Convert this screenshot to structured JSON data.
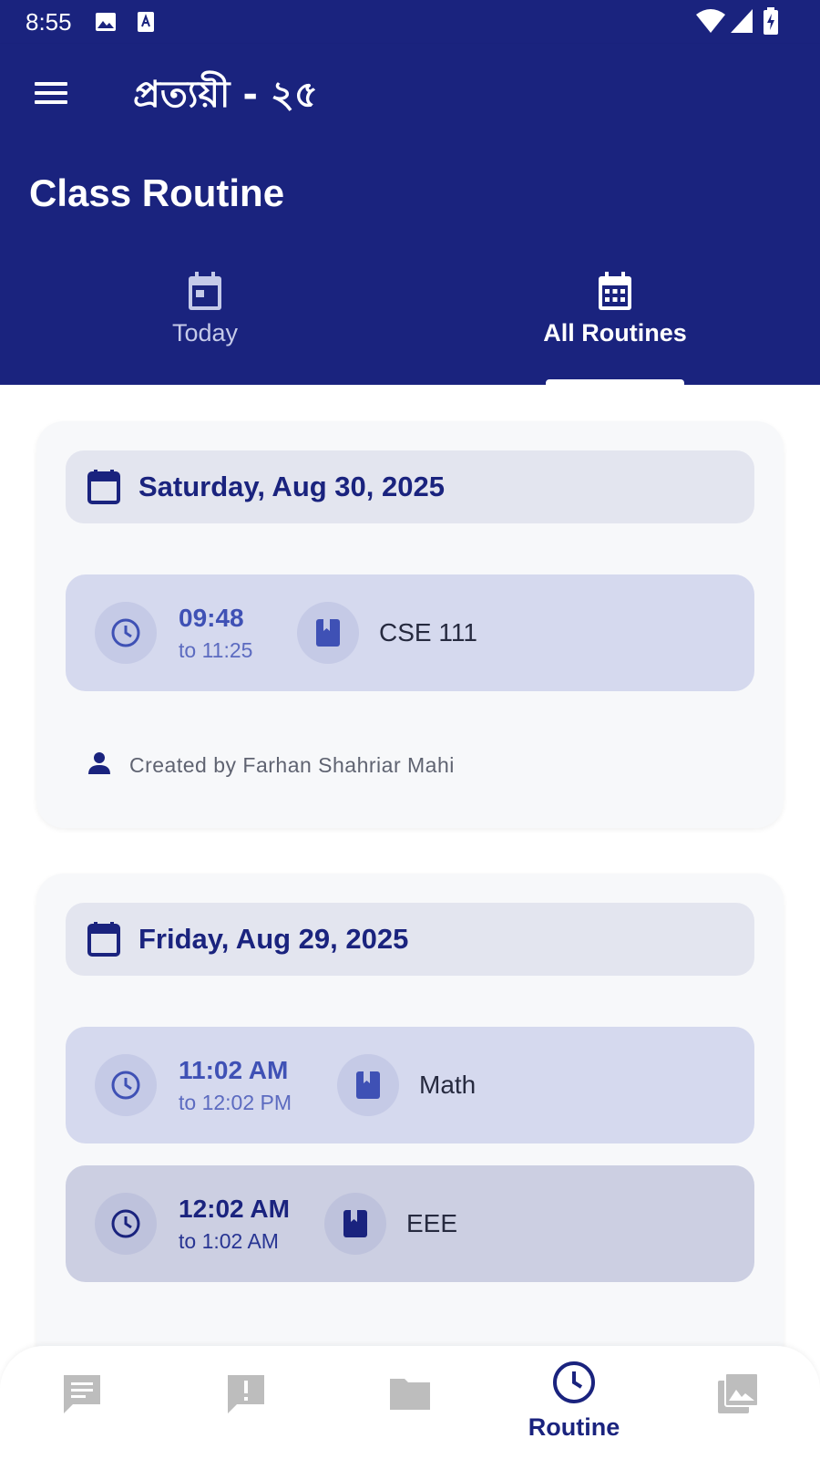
{
  "status_bar": {
    "time": "8:55"
  },
  "app_bar": {
    "title": "প্রত্যয়ী - ২৫"
  },
  "page": {
    "title": "Class Routine"
  },
  "tabs": [
    {
      "label": "Today",
      "selected": false
    },
    {
      "label": "All Routines",
      "selected": true
    }
  ],
  "routines": [
    {
      "date": "Saturday, Aug 30, 2025",
      "entries": [
        {
          "start": "09:48",
          "end": "to 11:25",
          "course": "CSE 111"
        }
      ],
      "created_by": "Created by Farhan Shahriar Mahi"
    },
    {
      "date": "Friday, Aug 29, 2025",
      "entries": [
        {
          "start": "11:02 AM",
          "end": "to 12:02 PM",
          "course": "Math"
        },
        {
          "start": "12:02 AM",
          "end": "to 1:02 AM",
          "course": "EEE"
        }
      ]
    }
  ],
  "bottom_nav": [
    {
      "icon": "chat-icon",
      "label": ""
    },
    {
      "icon": "alert-icon",
      "label": ""
    },
    {
      "icon": "folder-icon",
      "label": ""
    },
    {
      "icon": "clock-icon",
      "label": "Routine",
      "selected": true
    },
    {
      "icon": "photo-library-icon",
      "label": ""
    }
  ],
  "colors": {
    "primary": "#1a237e",
    "accent": "#3f51b5",
    "card_bg": "#f7f8fa",
    "date_pill_bg": "#e3e5ef",
    "entry_bg": "#d5d9ee",
    "entry_bg_alt": "#cccfe2"
  }
}
